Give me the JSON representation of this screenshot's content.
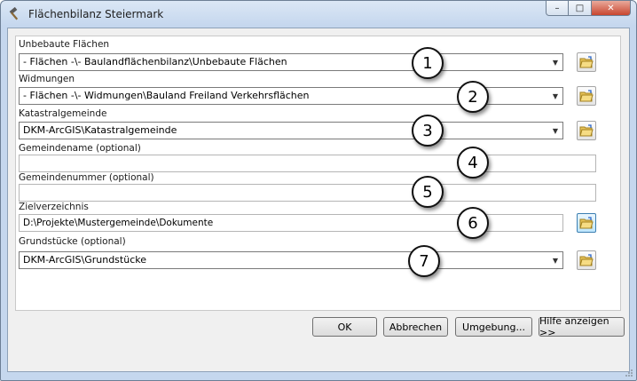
{
  "window": {
    "title": "Flächenbilanz Steiermark",
    "controls": {
      "minimize": "–",
      "maximize": "□",
      "close": "✕"
    }
  },
  "fields": [
    {
      "label": "Unbebaute Flächen",
      "value": "- Flächen -\\- Baulandflächenbilanz\\Unbebaute Flächen",
      "type": "combo",
      "callout": "1"
    },
    {
      "label": "Widmungen",
      "value": "- Flächen -\\- Widmungen\\Bauland Freiland Verkehrsflächen",
      "type": "combo",
      "callout": "2"
    },
    {
      "label": "Katastralgemeinde",
      "value": "DKM-ArcGIS\\Katastralgemeinde",
      "type": "combo",
      "callout": "3"
    },
    {
      "label": "Gemeindename (optional)",
      "value": "",
      "type": "text",
      "callout": "4"
    },
    {
      "label": "Gemeindenummer (optional)",
      "value": "",
      "type": "text",
      "callout": "5"
    },
    {
      "label": "Zielverzeichnis",
      "value": "D:\\Projekte\\Mustergemeinde\\Dokumente",
      "type": "text-browse",
      "callout": "6"
    },
    {
      "label": "Grundstücke (optional)",
      "value": "DKM-ArcGIS\\Grundstücke",
      "type": "combo",
      "callout": "7"
    }
  ],
  "buttons": {
    "ok": "OK",
    "cancel": "Abbrechen",
    "environment": "Umgebung...",
    "help": "Hilfe anzeigen >>"
  },
  "icons": {
    "title": "hammer-icon",
    "browse": "open-folder-icon",
    "dropdown": "chevron-down-icon"
  }
}
